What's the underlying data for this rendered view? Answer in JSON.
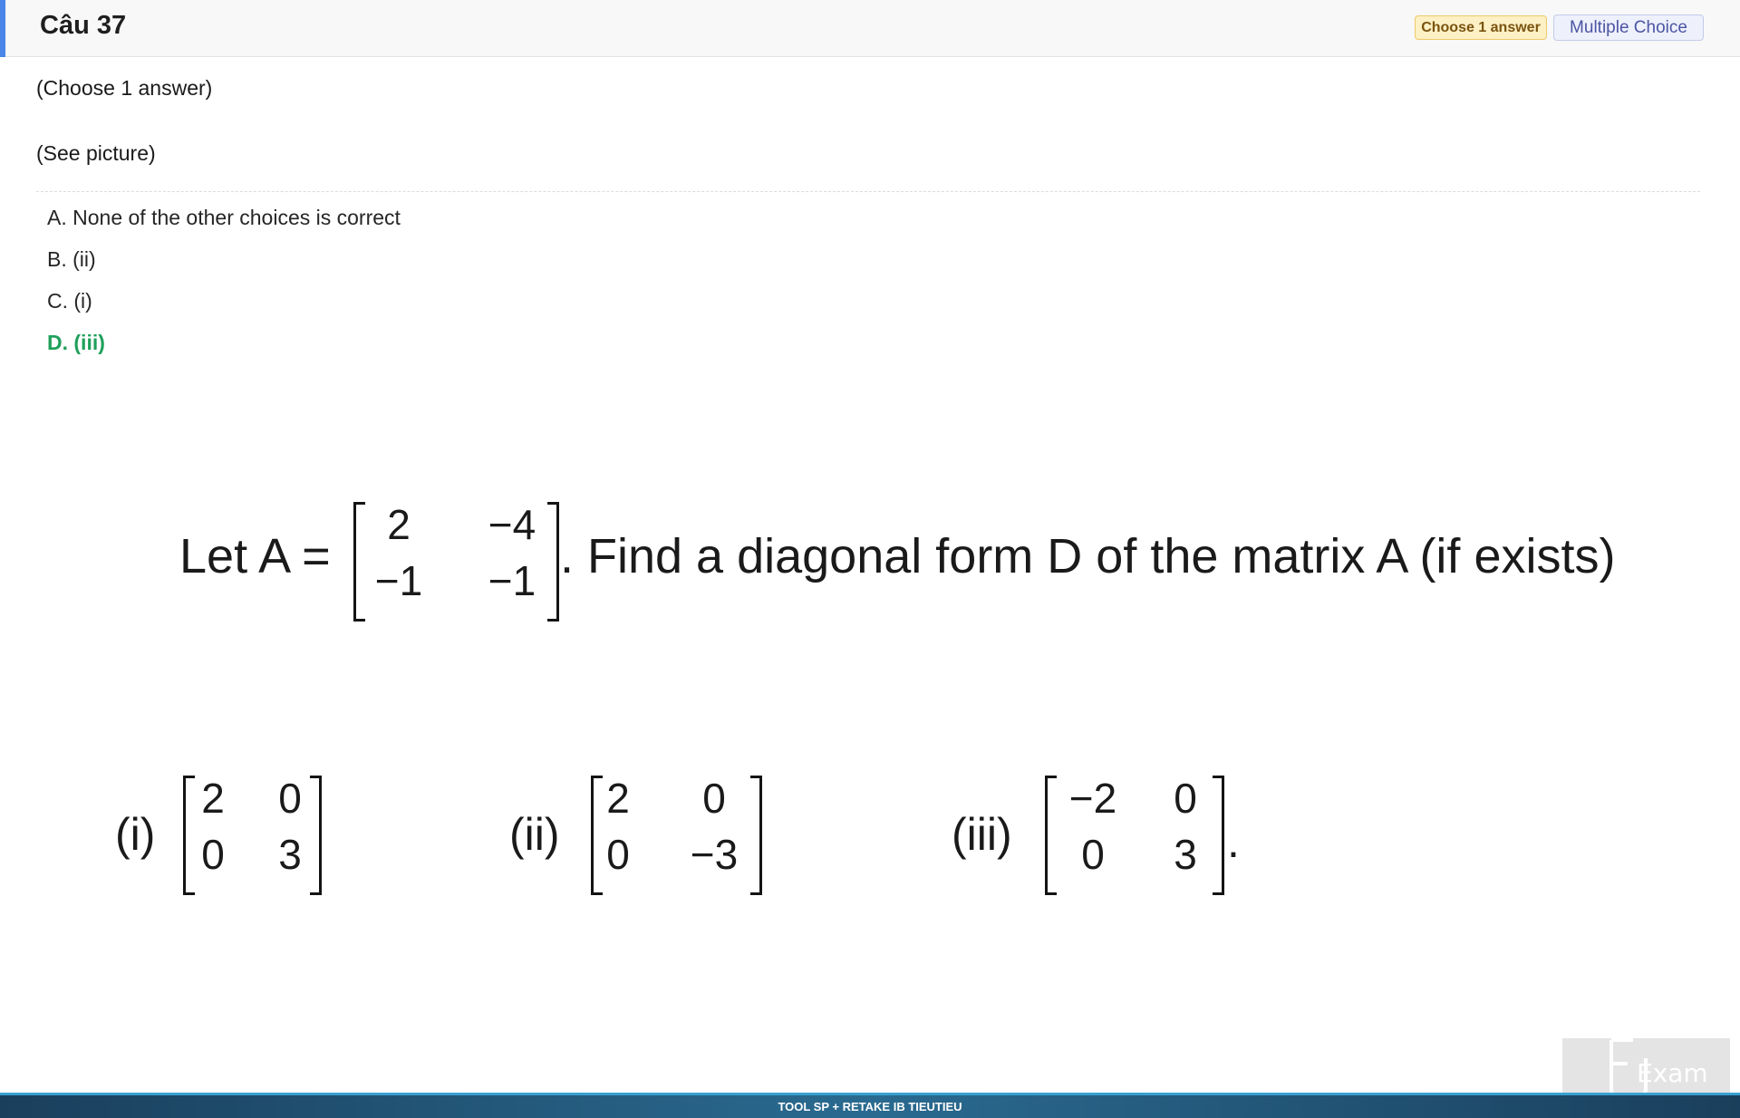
{
  "header": {
    "title": "Câu 37",
    "badge_choose": "Choose 1 answer",
    "badge_type": "Multiple Choice"
  },
  "instructions": {
    "choose": "(Choose 1 answer)",
    "see_picture": "(See picture)"
  },
  "choices": [
    {
      "text": "A. None of the other choices is correct",
      "correct": false
    },
    {
      "text": "B. (ii)",
      "correct": false
    },
    {
      "text": "C. (i)",
      "correct": false
    },
    {
      "text": "D. (iii)",
      "correct": true
    }
  ],
  "picture": {
    "prefix": "Let A =",
    "matrix_A": [
      [
        "2",
        "−4"
      ],
      [
        "−1",
        "−1"
      ]
    ],
    "suffix": ". Find a diagonal form D of the matrix A (if exists)",
    "options": [
      {
        "label": "(i)",
        "matrix": [
          [
            "2",
            "0"
          ],
          [
            "0",
            "3"
          ]
        ],
        "trail": ""
      },
      {
        "label": "(ii)",
        "matrix": [
          [
            "2",
            "0"
          ],
          [
            "0",
            "−3"
          ]
        ],
        "trail": ""
      },
      {
        "label": "(iii)",
        "matrix": [
          [
            "−2",
            "0"
          ],
          [
            "0",
            "3"
          ]
        ],
        "trail": "."
      }
    ]
  },
  "watermark": "Exam",
  "footer": "TOOL SP + RETAKE IB TIEUTIEU",
  "colors": {
    "accent": "#4a86e8",
    "correct": "#1fa05a"
  }
}
